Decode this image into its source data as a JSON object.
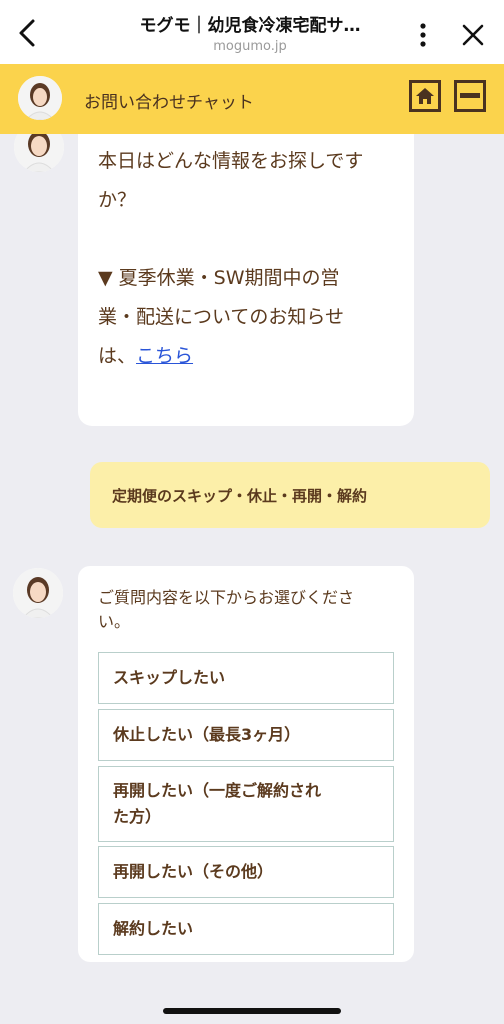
{
  "browser": {
    "title": "モグモ｜幼児食冷凍宅配サ…",
    "domain": "mogumo.jp"
  },
  "chat_header": {
    "title": "お問い合わせチャット"
  },
  "messages": {
    "bot1_line1": "本日はどんな情報をお探しです",
    "bot1_line2": "か？",
    "bot1_line3": "▼ 夏季休業・SW期間中の営",
    "bot1_line4": "業・配送についてのお知らせ",
    "bot1_line5_prefix": "は、",
    "bot1_link": "こちら",
    "user1": "定期便のスキップ・休止・再開・解約",
    "bot2_line1": "ご質問内容を以下からお選びくださ",
    "bot2_line2": "い。"
  },
  "options": [
    {
      "label": "スキップしたい"
    },
    {
      "label": "休止したい（最長3ヶ月）"
    },
    {
      "label_line1": "再開したい（一度ご解約され",
      "label_line2": "た方）"
    },
    {
      "label": "再開したい（その他）"
    },
    {
      "label": "解約したい"
    }
  ],
  "colors": {
    "header_yellow": "#fbd34c",
    "user_bubble": "#fcefa9",
    "text_brown": "#5b3a1e",
    "link_blue": "#2a55d8",
    "background": "#ededf2"
  },
  "icons": [
    "back-icon",
    "more-icon",
    "close-icon",
    "home-icon",
    "minimize-icon",
    "operator-avatar"
  ]
}
